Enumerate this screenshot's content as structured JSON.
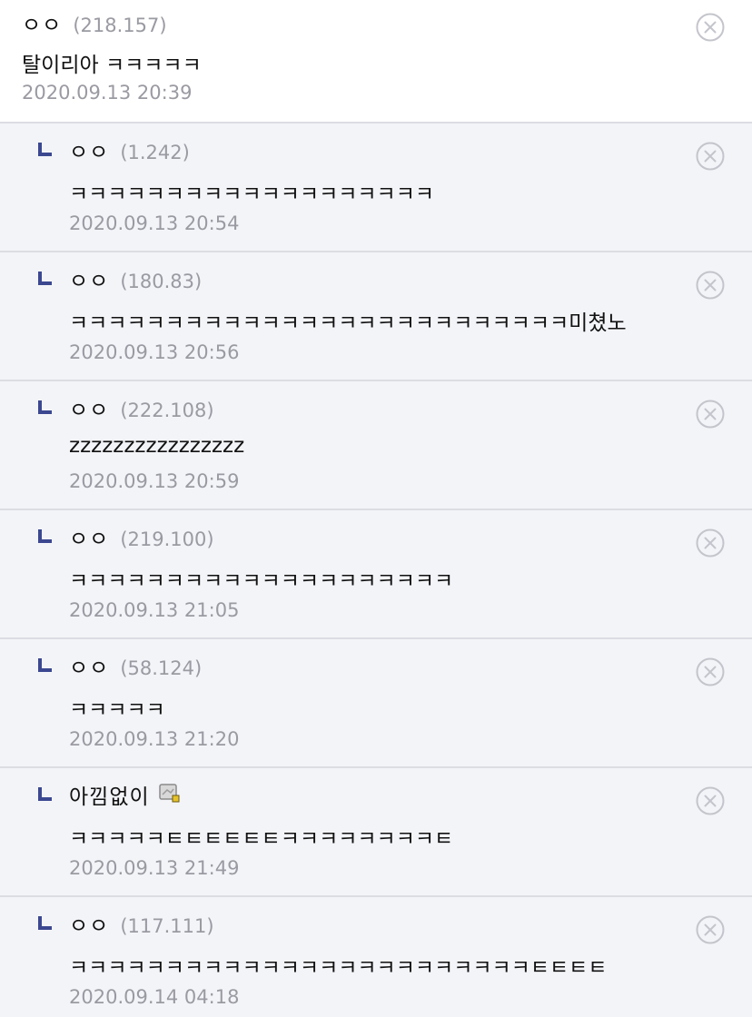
{
  "comments": [
    {
      "author": "ㅇㅇ",
      "ip": "(218.157)",
      "text": "탈이리아 ㅋㅋㅋㅋㅋ",
      "date": "2020.09.13 20:39"
    },
    {
      "author": "ㅇㅇ",
      "ip": "(1.242)",
      "text": "ㅋㅋㅋㅋㅋㅋㅋㅋㅋㅋㅋㅋㅋㅋㅋㅋㅋㅋㅋ",
      "date": "2020.09.13 20:54"
    },
    {
      "author": "ㅇㅇ",
      "ip": "(180.83)",
      "text": "ㅋㅋㅋㅋㅋㅋㅋㅋㅋㅋㅋㅋㅋㅋㅋㅋㅋㅋㅋㅋㅋㅋㅋㅋㅋㅋ미쳤노",
      "date": "2020.09.13 20:56"
    },
    {
      "author": "ㅇㅇ",
      "ip": "(222.108)",
      "text": "zzzzzzzzzzzzzzzz",
      "date": "2020.09.13 20:59"
    },
    {
      "author": "ㅇㅇ",
      "ip": "(219.100)",
      "text": "ㅋㅋㅋㅋㅋㅋㅋㅋㅋㅋㅋㅋㅋㅋㅋㅋㅋㅋㅋㅋ",
      "date": "2020.09.13 21:05"
    },
    {
      "author": "ㅇㅇ",
      "ip": "(58.124)",
      "text": "ㅋㅋㅋㅋㅋ",
      "date": "2020.09.13 21:20"
    },
    {
      "author": "아낌없이",
      "ip": "",
      "text": "ㅋㅋㅋㅋㅋㅌㅌㅌㅌㅌㅌㅋㅋㅋㅋㅋㅋㅋㅋㅌ",
      "date": "2020.09.13 21:49"
    },
    {
      "author": "ㅇㅇ",
      "ip": "(117.111)",
      "text": "ㅋㅋㅋㅋㅋㅋㅋㅋㅋㅋㅋㅋㅋㅋㅋㅋㅋㅋㅋㅋㅋㅋㅋㅋㅌㅌㅌㅌ",
      "date": "2020.09.14 04:18"
    }
  ],
  "icons": {
    "reply_marker": "reply-arrow-icon",
    "delete": "delete-x-icon",
    "gallog": "gallog-badge-icon"
  },
  "colors": {
    "reply_bg": "#f3f4f8",
    "divider": "#dcdde3",
    "meta_text": "#9a9aa2",
    "reply_marker": "#3b4890"
  }
}
